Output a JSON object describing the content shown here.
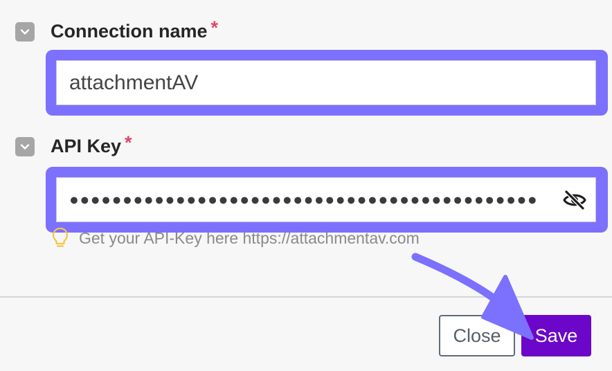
{
  "form": {
    "connection_name": {
      "label": "Connection name",
      "required_mark": "*",
      "value": "attachmentAV"
    },
    "api_key": {
      "label": "API Key",
      "required_mark": "*",
      "masked_value": "●●●●●●●●●●●●●●●●●●●●●●●●●●●●●●●●●●●●●●●●●●●●",
      "hint": "Get your API-Key here https://attachmentav.com"
    }
  },
  "footer": {
    "close_label": "Close",
    "save_label": "Save"
  },
  "icons": {
    "collapse": "chevron-down-icon",
    "visibility": "eye-off-icon",
    "hint": "lightbulb-icon"
  },
  "colors": {
    "highlight": "#7c70ff",
    "save_button": "#6c06c8",
    "required": "#e0456a",
    "hint_icon": "#f5c542"
  }
}
